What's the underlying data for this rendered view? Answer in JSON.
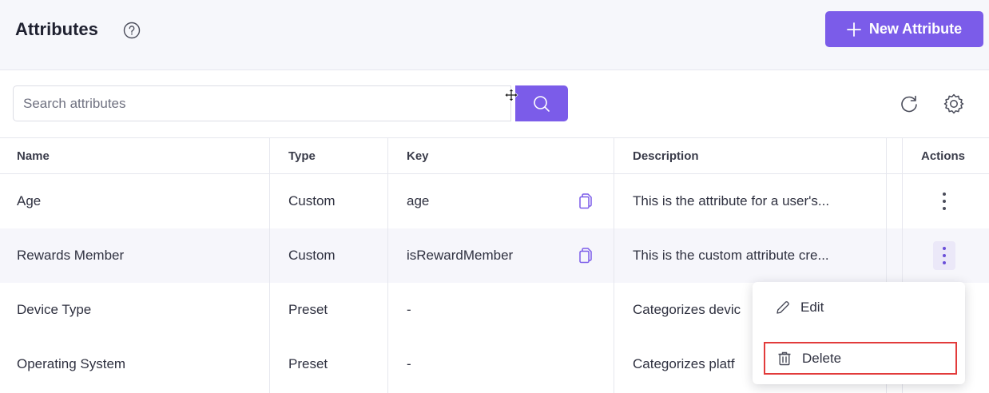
{
  "header": {
    "title": "Attributes",
    "new_button_label": "New Attribute"
  },
  "search": {
    "placeholder": "Search attributes",
    "value": ""
  },
  "table": {
    "columns": [
      "Name",
      "Type",
      "Key",
      "Description",
      "Actions"
    ],
    "rows": [
      {
        "name": "Age",
        "type": "Custom",
        "key": "age",
        "description": "This is the attribute for a user's..."
      },
      {
        "name": "Rewards Member",
        "type": "Custom",
        "key": "isRewardMember",
        "description": "This is the custom attribute cre..."
      },
      {
        "name": "Device Type",
        "type": "Preset",
        "key": "-",
        "description": "Categorizes devic"
      },
      {
        "name": "Operating System",
        "type": "Preset",
        "key": "-",
        "description": "Categorizes platf"
      }
    ]
  },
  "context_menu": {
    "items": [
      {
        "label": "Edit",
        "icon": "pencil-icon"
      },
      {
        "label": "Delete",
        "icon": "trash-icon"
      }
    ]
  },
  "colors": {
    "accent": "#7b5ce9",
    "highlight_border": "#e23b3b",
    "header_bg": "#f6f7fb"
  }
}
